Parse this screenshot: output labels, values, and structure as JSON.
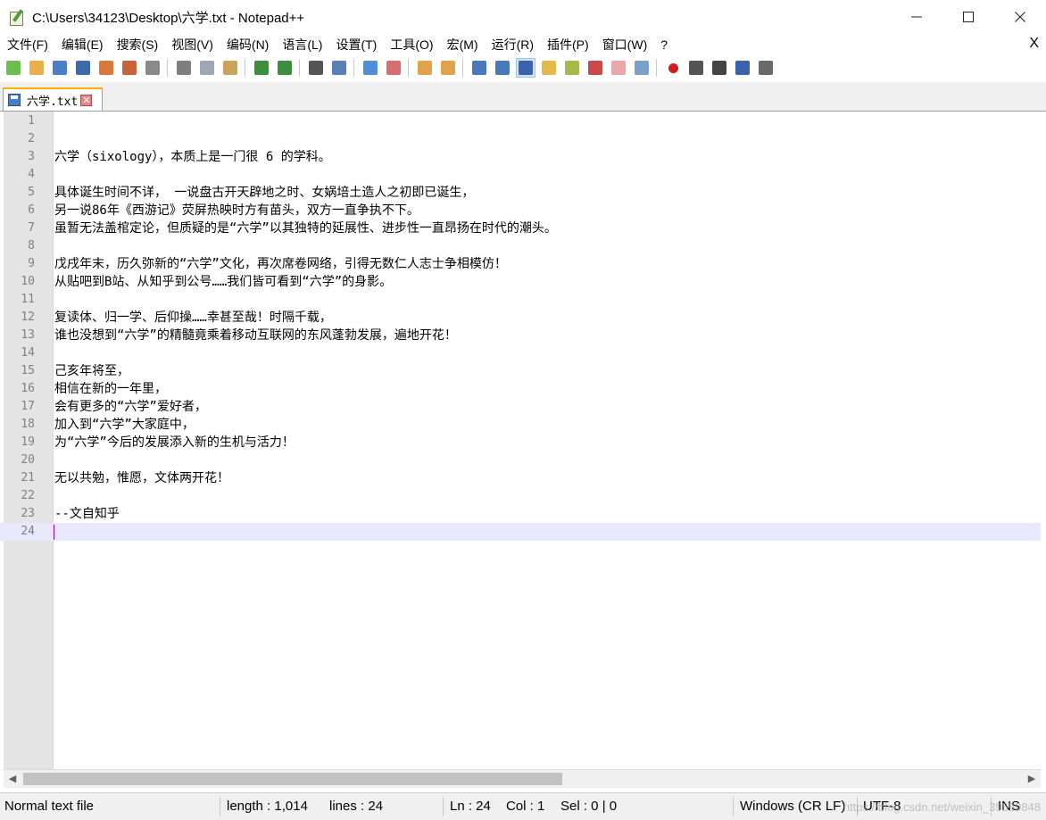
{
  "window": {
    "title": "C:\\Users\\34123\\Desktop\\六学.txt - Notepad++",
    "minimize": "—",
    "maximize": "☐",
    "close": "✕"
  },
  "menu": {
    "items": [
      "文件(F)",
      "编辑(E)",
      "搜索(S)",
      "视图(V)",
      "编码(N)",
      "语言(L)",
      "设置(T)",
      "工具(O)",
      "宏(M)",
      "运行(R)",
      "插件(P)",
      "窗口(W)",
      "?"
    ],
    "close_doc": "X"
  },
  "toolbar": {
    "icons": [
      {
        "name": "new-file-icon",
        "color": "#6bbf4e"
      },
      {
        "name": "open-file-icon",
        "color": "#e8b04a"
      },
      {
        "name": "save-icon",
        "color": "#4a7fc4"
      },
      {
        "name": "save-all-icon",
        "color": "#3d6aa8"
      },
      {
        "name": "close-file-icon",
        "color": "#d9783c"
      },
      {
        "name": "close-all-icon",
        "color": "#c8623a"
      },
      {
        "name": "print-icon",
        "color": "#8a8a8a"
      },
      {
        "name": "cut-icon",
        "color": "#7f7f7f"
      },
      {
        "name": "copy-icon",
        "color": "#9fa7b6"
      },
      {
        "name": "paste-icon",
        "color": "#c9a45a"
      },
      {
        "name": "undo-icon",
        "color": "#3d8f3d"
      },
      {
        "name": "redo-icon",
        "color": "#3d8f3d"
      },
      {
        "name": "find-icon",
        "color": "#555555"
      },
      {
        "name": "replace-icon",
        "color": "#5a7fb5"
      },
      {
        "name": "zoom-in-icon",
        "color": "#4f8fd8"
      },
      {
        "name": "zoom-out-icon",
        "color": "#d86f6f"
      },
      {
        "name": "sync-vertical-icon",
        "color": "#e0a24a"
      },
      {
        "name": "sync-horizontal-icon",
        "color": "#e0a24a"
      },
      {
        "name": "word-wrap-icon",
        "color": "#4a78b8"
      },
      {
        "name": "show-all-chars-icon",
        "color": "#4a78b8"
      },
      {
        "name": "indent-guide-icon",
        "color": "#3a62a8"
      },
      {
        "name": "user-define-language-icon",
        "color": "#e5b84a"
      },
      {
        "name": "document-map-icon",
        "color": "#a8b84a"
      },
      {
        "name": "function-list-icon",
        "color": "#c84a4a"
      },
      {
        "name": "folder-as-workspace-icon",
        "color": "#e8a8a8"
      },
      {
        "name": "monitoring-icon",
        "color": "#7a9fc8"
      },
      {
        "name": "record-macro-icon",
        "color": "#d11a1a"
      },
      {
        "name": "stop-recording-icon",
        "color": "#555555"
      },
      {
        "name": "playback-macro-icon",
        "color": "#444444"
      },
      {
        "name": "run-macro-multiple-icon",
        "color": "#3a62a8"
      },
      {
        "name": "save-macro-icon",
        "color": "#6a6a6a"
      }
    ]
  },
  "tab": {
    "label": "六学.txt",
    "close": "✕"
  },
  "editor": {
    "current_line": 24,
    "lines": [
      {
        "n": "1",
        "text": ""
      },
      {
        "n": "2",
        "text": ""
      },
      {
        "n": "3",
        "text": "六学（sixology），本质上是一门很 6 的学科。"
      },
      {
        "n": "4",
        "text": ""
      },
      {
        "n": "5",
        "text": "具体诞生时间不详， 一说盘古开天辟地之时、女娲培土造人之初即已诞生，"
      },
      {
        "n": "6",
        "text": "另一说86年《西游记》荧屏热映时方有苗头，双方一直争执不下。"
      },
      {
        "n": "7",
        "text": "虽暂无法盖棺定论，但质疑的是“六学”以其独特的延展性、进步性一直昂扬在时代的潮头。"
      },
      {
        "n": "8",
        "text": ""
      },
      {
        "n": "9",
        "text": "戊戌年末，历久弥新的“六学”文化，再次席卷网络，引得无数仁人志士争相模仿！"
      },
      {
        "n": "10",
        "text": "从贴吧到B站、从知乎到公号……我们皆可看到“六学”的身影。"
      },
      {
        "n": "11",
        "text": ""
      },
      {
        "n": "12",
        "text": "复读体、归一学、后仰操……幸甚至哉！时隔千载，"
      },
      {
        "n": "13",
        "text": "谁也没想到“六学”的精髓竟乘着移动互联网的东风蓬勃发展，遍地开花！"
      },
      {
        "n": "14",
        "text": ""
      },
      {
        "n": "15",
        "text": "己亥年将至，"
      },
      {
        "n": "16",
        "text": "相信在新的一年里，"
      },
      {
        "n": "17",
        "text": "会有更多的“六学”爱好者，"
      },
      {
        "n": "18",
        "text": "加入到“六学”大家庭中，"
      },
      {
        "n": "19",
        "text": "为“六学”今后的发展添入新的生机与活力！"
      },
      {
        "n": "20",
        "text": ""
      },
      {
        "n": "21",
        "text": "无以共勉，惟愿，文体两开花！"
      },
      {
        "n": "22",
        "text": ""
      },
      {
        "n": "23",
        "text": "--文自知乎"
      },
      {
        "n": "24",
        "text": ""
      }
    ]
  },
  "scrollbar": {
    "left_arrow": "◀",
    "right_arrow": "▶"
  },
  "status": {
    "file_type": "Normal text file",
    "length": "length : 1,014",
    "lines": "lines : 24",
    "ln": "Ln : 24",
    "col": "Col : 1",
    "sel": "Sel : 0 | 0",
    "eol": "Windows (CR LF)",
    "encoding": "UTF-8",
    "mode": "INS",
    "watermark": "https://blog.csdn.net/weixin_39559848"
  }
}
